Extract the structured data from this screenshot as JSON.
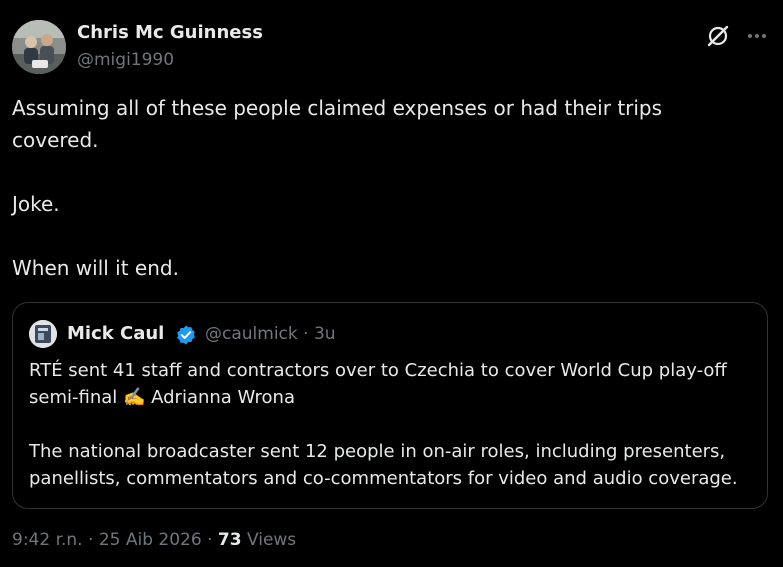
{
  "author": {
    "name": "Chris Mc Guinness",
    "handle": "@migi1990"
  },
  "tweet": {
    "line1": "Assuming all of these people claimed expenses or had their trips covered.",
    "line2": "Joke.",
    "line3": "When will it end."
  },
  "quote": {
    "name": "Mick Caul",
    "handle": "@caulmick",
    "separator": "·",
    "age": "3u",
    "para1": "RTÉ sent 41 staff and contractors over to Czechia to cover World Cup play-off semi-final ✍️ Adrianna Wrona",
    "para2": "The national broadcaster sent 12 people in on-air roles, including presenters, panellists, commentators and co-commentators for video and audio coverage."
  },
  "meta": {
    "time": "9:42 r.n.",
    "separator": "·",
    "date": "25 Aib 2026",
    "views_count": "73",
    "views_label": "Views"
  },
  "icons": {
    "grok": "grok-icon",
    "more": "more-icon",
    "verified": "verified-badge-icon"
  },
  "colors": {
    "background": "#000000",
    "text": "#e7e9ea",
    "muted": "#71767b",
    "border": "#2f3336",
    "verified": "#1d9bf0"
  }
}
